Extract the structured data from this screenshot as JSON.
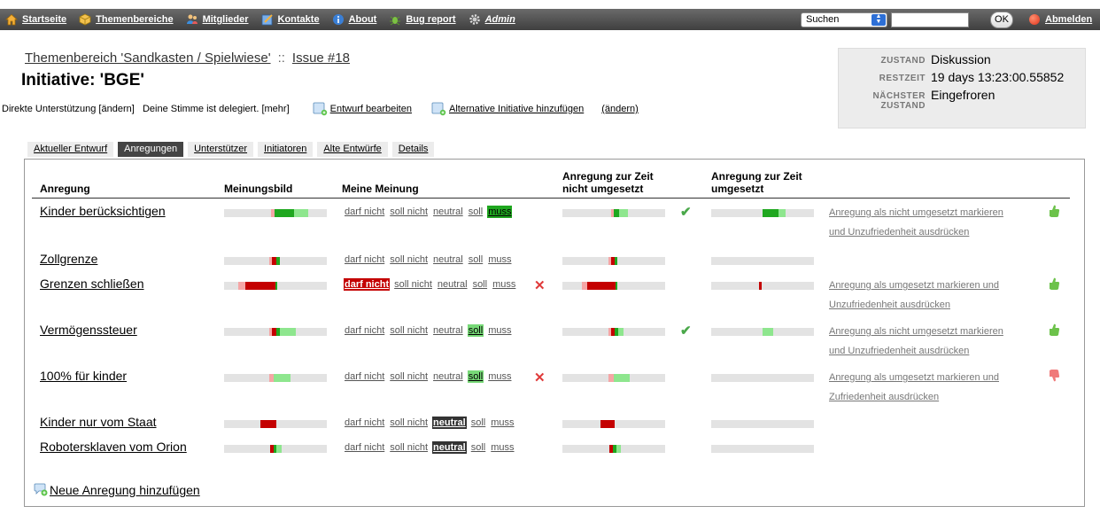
{
  "nav": {
    "items": [
      {
        "label": "Startseite",
        "icon": "home-icon"
      },
      {
        "label": "Themenbereiche",
        "icon": "package-icon"
      },
      {
        "label": "Mitglieder",
        "icon": "members-icon"
      },
      {
        "label": "Kontakte",
        "icon": "contacts-icon"
      },
      {
        "label": "About",
        "icon": "info-icon"
      },
      {
        "label": "Bug report",
        "icon": "bug-icon"
      },
      {
        "label": "Admin",
        "icon": "gear-icon"
      }
    ],
    "search_select": "Suchen",
    "ok": "OK",
    "logout": "Abmelden"
  },
  "header": {
    "breadcrumb_area": "Themenbereich 'Sandkasten / Spielwiese'",
    "breadcrumb_sep": "::",
    "breadcrumb_issue": "Issue #18",
    "title": "Initiative: 'BGE'",
    "support_text": "Direkte Unterstützung [ändern]   Deine Stimme ist delegiert. [mehr]",
    "edit_draft": "Entwurf bearbeiten",
    "add_alternative": "Alternative Initiative hinzufügen",
    "change": "(ändern)"
  },
  "state": {
    "zustand_label": "ZUSTAND",
    "zustand": "Diskussion",
    "restzeit_label": "RESTZEIT",
    "restzeit": "19 days 13:23:00.55852",
    "next_label_1": "NÄCHSTER",
    "next_label_2": "ZUSTAND",
    "next": "Eingefroren"
  },
  "tabs": [
    "Aktueller Entwurf",
    "Anregungen",
    "Unterstützer",
    "Initiatoren",
    "Alte Entwürfe",
    "Details"
  ],
  "active_tab": 1,
  "columns": {
    "anregung": "Anregung",
    "meinungsbild": "Meinungsbild",
    "meine_meinung": "Meine Meinung",
    "nicht_umgesetzt_1": "Anregung zur Zeit",
    "nicht_umgesetzt_2": "nicht umgesetzt",
    "umgesetzt_1": "Anregung zur Zeit",
    "umgesetzt_2": "umgesetzt"
  },
  "opinion_labels": [
    "darf nicht",
    "soll nicht",
    "neutral",
    "soll",
    "muss"
  ],
  "colors": {
    "dark_red": "#c40000",
    "light_red": "#f5a6a6",
    "dark_green": "#1fa71f",
    "light_green": "#8ee68e",
    "bar_bg": "#e3e3e3"
  },
  "suggestions": [
    {
      "name": "Kinder berücksichtigen",
      "selected": "muss",
      "mark": "check",
      "action_1": "Anregung als nicht umgesetzt markieren",
      "action_2": "und Unzufriedenheit ausdrücken",
      "thumb": "thumb-up-icon"
    },
    {
      "name": "Zollgrenze",
      "selected": "",
      "mark": "",
      "action_1": "",
      "action_2": "",
      "thumb": ""
    },
    {
      "name": "Grenzen schließen",
      "selected": "darf nicht",
      "mark": "cross",
      "action_1": "Anregung als umgesetzt markieren und",
      "action_2": "Unzufriedenheit ausdrücken",
      "thumb": "thumb-up-icon"
    },
    {
      "name": "Vermögenssteuer",
      "selected": "soll",
      "mark": "check",
      "action_1": "Anregung als nicht umgesetzt markieren",
      "action_2": "und Unzufriedenheit ausdrücken",
      "thumb": "thumb-up-icon"
    },
    {
      "name": "100% für kinder",
      "selected": "soll",
      "mark": "cross",
      "action_1": "Anregung als umgesetzt markieren und",
      "action_2": "Zufriedenheit ausdrücken",
      "thumb": "thumb-down-icon"
    },
    {
      "name": "Kinder nur vom Staat",
      "selected": "neutral",
      "mark": "",
      "action_1": "",
      "action_2": "",
      "thumb": ""
    },
    {
      "name": "Robotersklaven vom Orion",
      "selected": "neutral",
      "mark": "",
      "action_1": "",
      "action_2": "",
      "thumb": ""
    }
  ],
  "new_suggestion": "Neue Anregung hinzufügen"
}
